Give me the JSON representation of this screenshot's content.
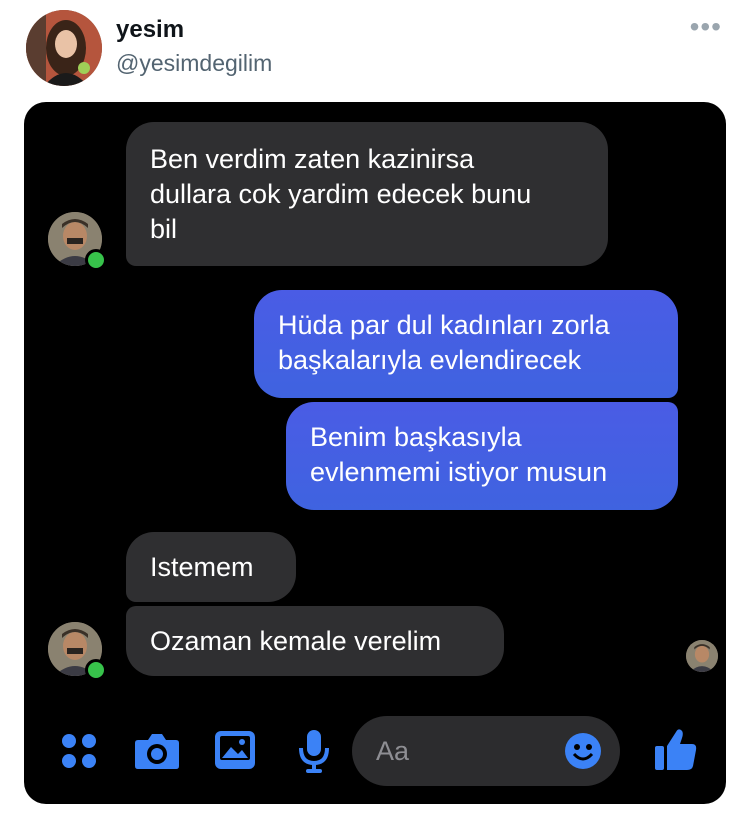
{
  "tweet": {
    "display_name": "yesim",
    "handle": "@yesimdegilim",
    "more_icon": "more-horizontal-icon"
  },
  "chat": {
    "messages": [
      {
        "from": "other",
        "lines": [
          "Ben verdim zaten kazinirsa",
          "dullara cok yardim edecek bunu",
          "bil"
        ]
      },
      {
        "from": "me",
        "lines": [
          "Hüda par dul kadınları zorla",
          "başkalarıyla evlendirecek"
        ]
      },
      {
        "from": "me",
        "lines": [
          "Benim başkasıyla",
          "evlenmemi istiyor musun"
        ]
      },
      {
        "from": "other",
        "lines": [
          "Istemem"
        ]
      },
      {
        "from": "other",
        "lines": [
          "Ozaman kemale verelim"
        ]
      }
    ],
    "input": {
      "placeholder": "Aa"
    },
    "toolbar_icons": [
      "apps-grid-icon",
      "camera-icon",
      "image-gallery-icon",
      "microphone-icon",
      "emoji-icon",
      "thumbs-up-icon"
    ],
    "accent_color": "#3b82f6",
    "online_color": "#37c24b"
  }
}
